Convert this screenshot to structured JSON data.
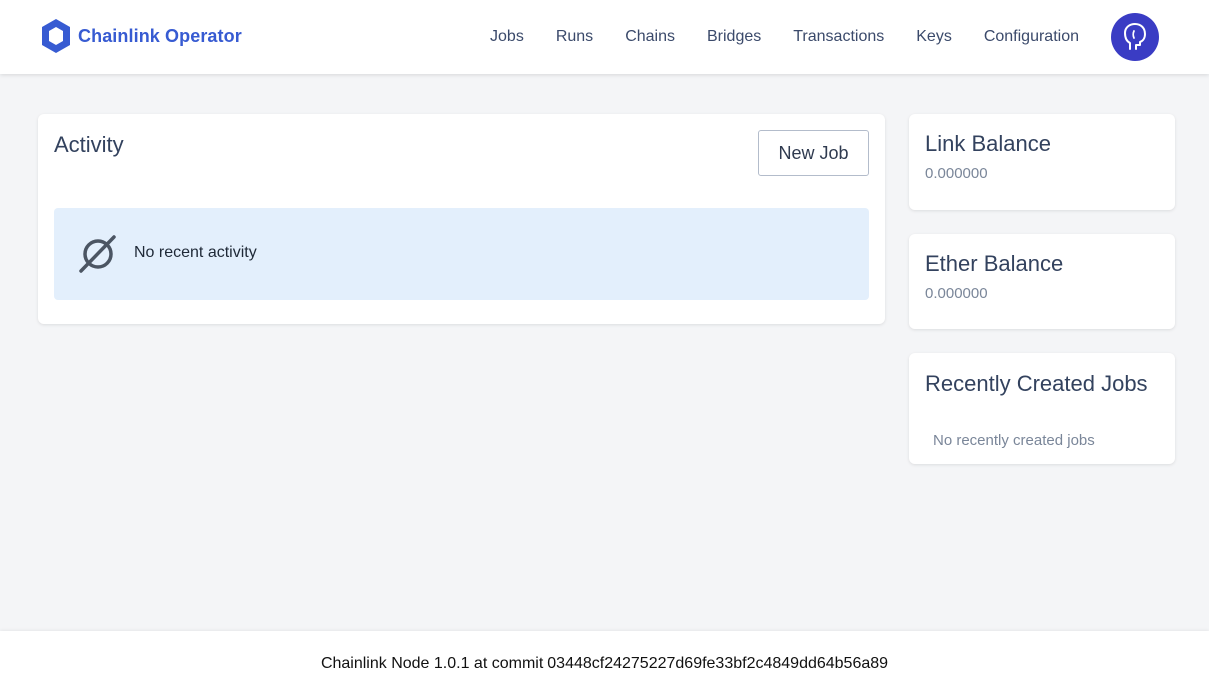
{
  "brand": {
    "name": "Chainlink Operator",
    "logo_icon": "chainlink-hexagon-icon",
    "color": "#375bd2"
  },
  "nav": {
    "items": [
      {
        "label": "Jobs"
      },
      {
        "label": "Runs"
      },
      {
        "label": "Chains"
      },
      {
        "label": "Bridges"
      },
      {
        "label": "Transactions"
      },
      {
        "label": "Keys"
      },
      {
        "label": "Configuration"
      }
    ],
    "avatar_icon": "user-avatar-icon",
    "avatar_color": "#3a3cc4"
  },
  "activity": {
    "title": "Activity",
    "new_job_label": "New Job",
    "empty_icon": "empty-set-icon",
    "empty_text": "No recent activity"
  },
  "link_balance": {
    "title": "Link Balance",
    "value": "0.000000"
  },
  "ether_balance": {
    "title": "Ether Balance",
    "value": "0.000000"
  },
  "recent_jobs": {
    "title": "Recently Created Jobs",
    "empty_text": "No recently created jobs"
  },
  "footer": {
    "prefix": "Chainlink Node 1.0.1 at commit",
    "commit": "03448cf24275227d69fe33bf2c4849dd64b56a89"
  }
}
